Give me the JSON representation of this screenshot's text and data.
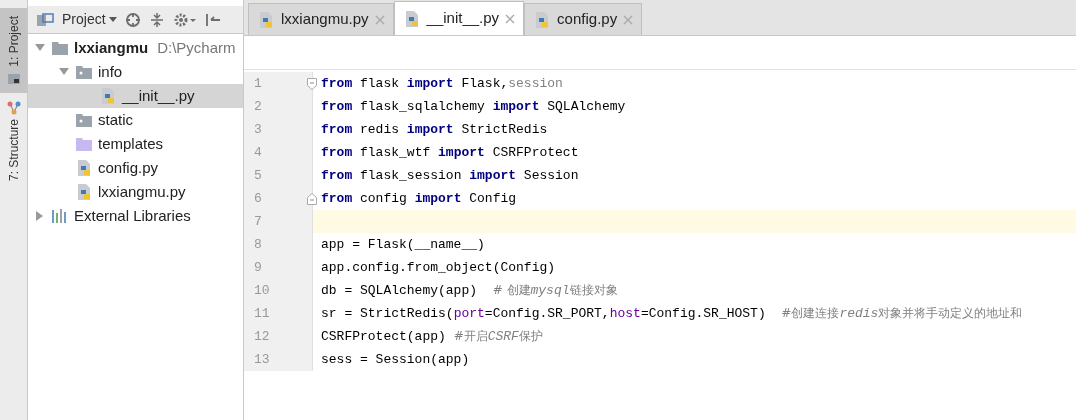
{
  "tool_strip": [
    {
      "label": "1: Project",
      "selected": true
    },
    {
      "label": "7: Structure",
      "selected": false
    }
  ],
  "project_panel": {
    "title": "Project",
    "tree": [
      {
        "label": "lxxiangmu",
        "kind": "folder",
        "bold": true,
        "path": "D:\\Pycharm",
        "expanded": true,
        "selected": false,
        "children": [
          {
            "label": "info",
            "kind": "package",
            "expanded": true,
            "selected": false,
            "children": [
              {
                "label": "__init__.py",
                "kind": "python",
                "selected": true
              }
            ]
          },
          {
            "label": "static",
            "kind": "package",
            "selected": false
          },
          {
            "label": "templates",
            "kind": "templates",
            "selected": false
          },
          {
            "label": "config.py",
            "kind": "python",
            "selected": false
          },
          {
            "label": "lxxiangmu.py",
            "kind": "python",
            "selected": false
          }
        ]
      },
      {
        "label": "External Libraries",
        "kind": "libraries",
        "expanded": false,
        "selected": false
      }
    ]
  },
  "editor_tabs": [
    {
      "label": "lxxiangmu.py",
      "selected": false
    },
    {
      "label": "__init__.py",
      "selected": true
    },
    {
      "label": "config.py",
      "selected": false
    }
  ],
  "code_lines": [
    {
      "number": "1",
      "fold_start": true,
      "current": false,
      "tokens": [
        {
          "kind": "keyword",
          "text": "from"
        },
        {
          "kind": "plain",
          "text": " flask "
        },
        {
          "kind": "keyword",
          "text": "import"
        },
        {
          "kind": "plain",
          "text": " Flask,"
        },
        {
          "kind": "unused",
          "text": "session"
        }
      ]
    },
    {
      "number": "2",
      "current": false,
      "tokens": [
        {
          "kind": "keyword",
          "text": "from"
        },
        {
          "kind": "plain",
          "text": " flask_sqlalchemy "
        },
        {
          "kind": "keyword",
          "text": "import"
        },
        {
          "kind": "plain",
          "text": " SQLAlchemy"
        }
      ]
    },
    {
      "number": "3",
      "current": false,
      "tokens": [
        {
          "kind": "keyword",
          "text": "from"
        },
        {
          "kind": "plain",
          "text": " redis "
        },
        {
          "kind": "keyword",
          "text": "import"
        },
        {
          "kind": "plain",
          "text": " StrictRedis"
        }
      ]
    },
    {
      "number": "4",
      "current": false,
      "tokens": [
        {
          "kind": "keyword",
          "text": "from"
        },
        {
          "kind": "plain",
          "text": " flask_wtf "
        },
        {
          "kind": "keyword",
          "text": "import"
        },
        {
          "kind": "plain",
          "text": " CSRFProtect"
        }
      ]
    },
    {
      "number": "5",
      "current": false,
      "tokens": [
        {
          "kind": "keyword",
          "text": "from"
        },
        {
          "kind": "plain",
          "text": " flask_session "
        },
        {
          "kind": "keyword",
          "text": "import"
        },
        {
          "kind": "plain",
          "text": " Session"
        }
      ]
    },
    {
      "number": "6",
      "fold_end": true,
      "current": false,
      "tokens": [
        {
          "kind": "keyword",
          "text": "from"
        },
        {
          "kind": "plain",
          "text": " config "
        },
        {
          "kind": "keyword",
          "text": "import"
        },
        {
          "kind": "plain",
          "text": " Config"
        }
      ]
    },
    {
      "number": "7",
      "current": true
    },
    {
      "number": "8",
      "current": false,
      "tokens": [
        {
          "kind": "plain",
          "text": "app = Flask(__name__)"
        }
      ]
    },
    {
      "number": "9",
      "current": false,
      "tokens": [
        {
          "kind": "plain",
          "text": "app.config.from_object(Config)"
        }
      ]
    },
    {
      "number": "10",
      "current": false,
      "tokens": [
        {
          "kind": "plain",
          "text": "db = SQLAlchemy(app)  "
        },
        {
          "kind": "comment",
          "text": "# 创建"
        },
        {
          "kind": "comment_italic",
          "text": "mysql"
        },
        {
          "kind": "comment",
          "text": "链接对象"
        }
      ]
    },
    {
      "number": "11",
      "current": false,
      "tokens": [
        {
          "kind": "plain",
          "text": "sr = StrictRedis("
        },
        {
          "kind": "param",
          "text": "port"
        },
        {
          "kind": "plain",
          "text": "=Config.SR_PORT,"
        },
        {
          "kind": "param",
          "text": "host"
        },
        {
          "kind": "plain",
          "text": "=Config.SR_HOST)  "
        },
        {
          "kind": "comment",
          "text": "#创建连接"
        },
        {
          "kind": "comment_italic",
          "text": "redis"
        },
        {
          "kind": "comment",
          "text": "对象并将手动定义的地址和"
        }
      ]
    },
    {
      "number": "12",
      "current": false,
      "tokens": [
        {
          "kind": "plain",
          "text": "CSRFProtect(app) "
        },
        {
          "kind": "comment",
          "text": "#开启"
        },
        {
          "kind": "comment_italic",
          "text": "CSRF"
        },
        {
          "kind": "comment",
          "text": "保护"
        }
      ]
    },
    {
      "number": "13",
      "current": false,
      "tokens": [
        {
          "kind": "plain",
          "text": "sess = Session(app)"
        }
      ]
    }
  ]
}
